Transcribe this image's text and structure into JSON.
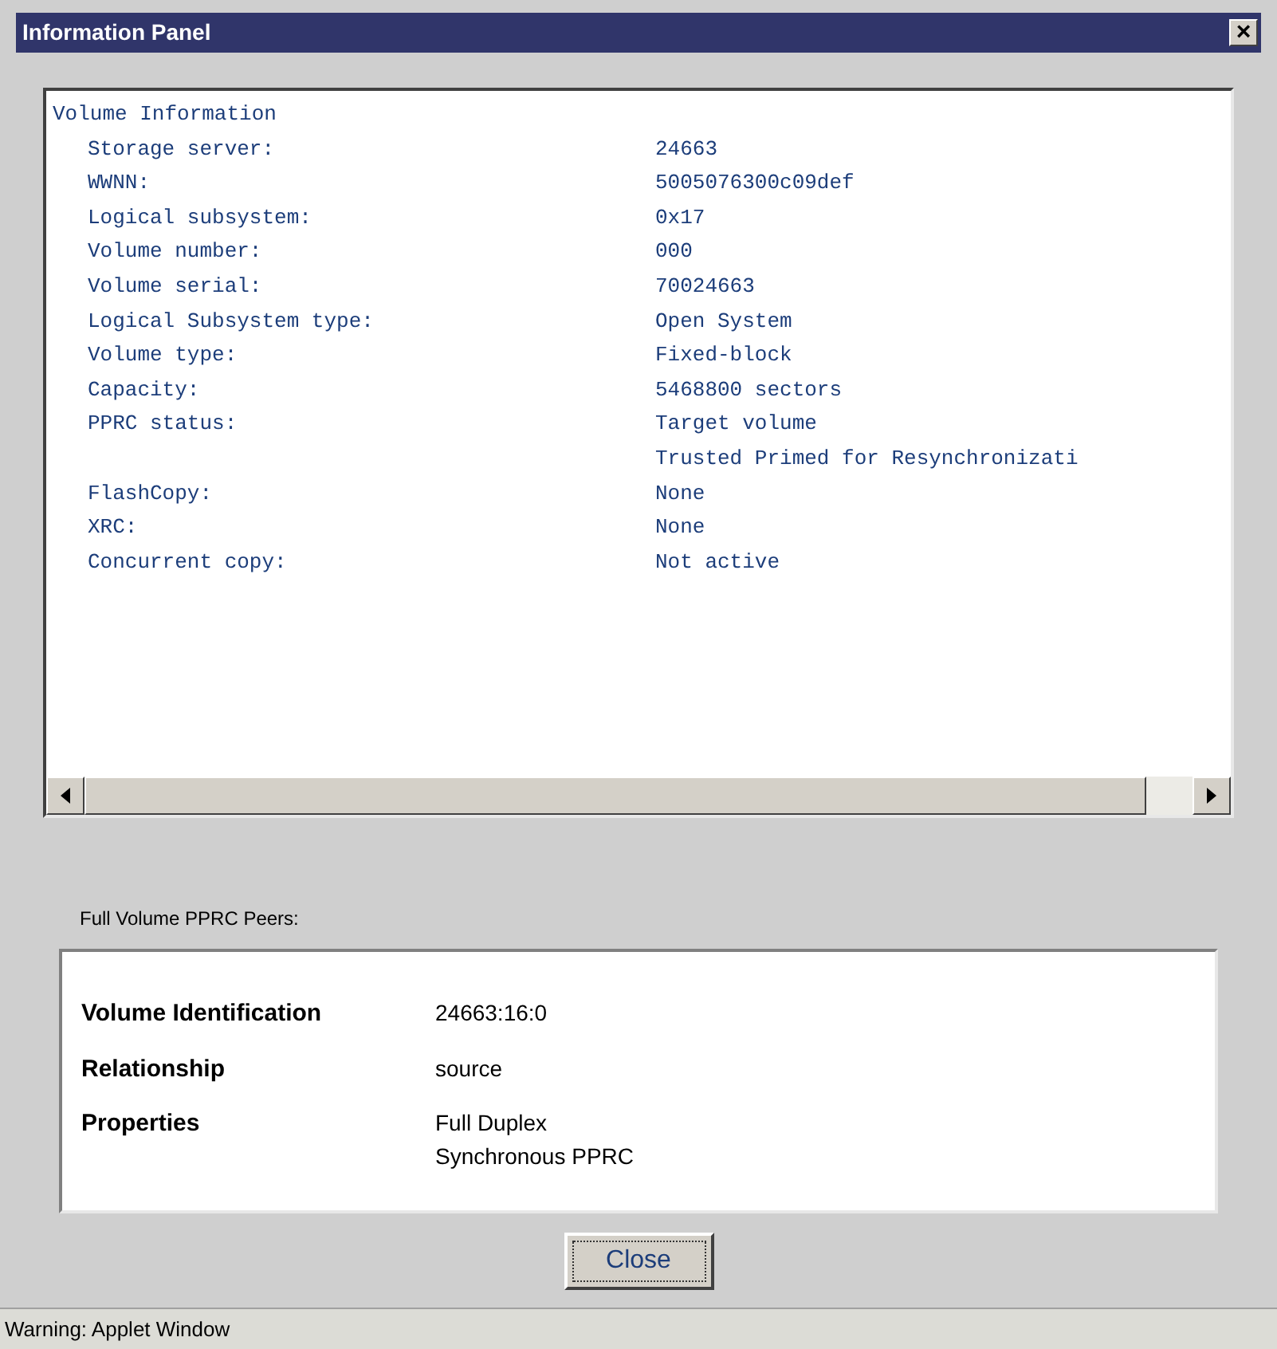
{
  "window": {
    "title": "Information Panel",
    "close_glyph": "×"
  },
  "volume_info": {
    "heading": "Volume Information",
    "rows": [
      {
        "label": "Storage server:",
        "values": [
          "24663"
        ]
      },
      {
        "label": "WWNN:",
        "values": [
          "5005076300c09def"
        ]
      },
      {
        "label": "Logical subsystem:",
        "values": [
          "0x17"
        ]
      },
      {
        "label": "Volume number:",
        "values": [
          "000"
        ]
      },
      {
        "label": "Volume serial:",
        "values": [
          "70024663"
        ]
      },
      {
        "label": "Logical Subsystem type:",
        "values": [
          "Open System"
        ]
      },
      {
        "label": "Volume type:",
        "values": [
          "Fixed-block"
        ]
      },
      {
        "label": "Capacity:",
        "values": [
          "5468800 sectors"
        ]
      },
      {
        "label": "PPRC status:",
        "values": [
          "Target volume",
          "Trusted Primed for Resynchronizati"
        ]
      },
      {
        "label": "FlashCopy:",
        "values": [
          "None"
        ]
      },
      {
        "label": "XRC:",
        "values": [
          "None"
        ]
      },
      {
        "label": "Concurrent copy:",
        "values": [
          "Not active"
        ]
      }
    ]
  },
  "peers": {
    "label": "Full Volume PPRC Peers:",
    "rows": [
      {
        "label": "Volume Identification",
        "values": [
          "24663:16:0"
        ]
      },
      {
        "label": "Relationship",
        "values": [
          "source"
        ]
      },
      {
        "label": "Properties",
        "values": [
          "Full Duplex",
          "Synchronous PPRC"
        ]
      }
    ]
  },
  "buttons": [
    {
      "label": "Close"
    }
  ],
  "status_bar": "Warning: Applet Window"
}
